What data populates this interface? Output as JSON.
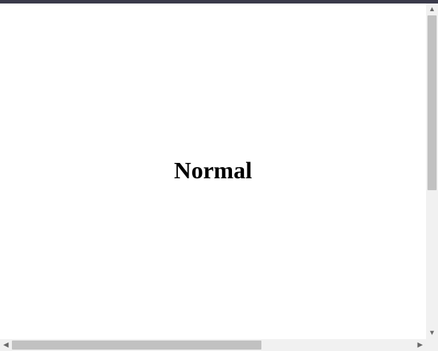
{
  "content": {
    "center_text": "Normal"
  },
  "scroll": {
    "arrow_up": "▲",
    "arrow_down": "▼",
    "arrow_left": "◀",
    "arrow_right": "▶"
  }
}
